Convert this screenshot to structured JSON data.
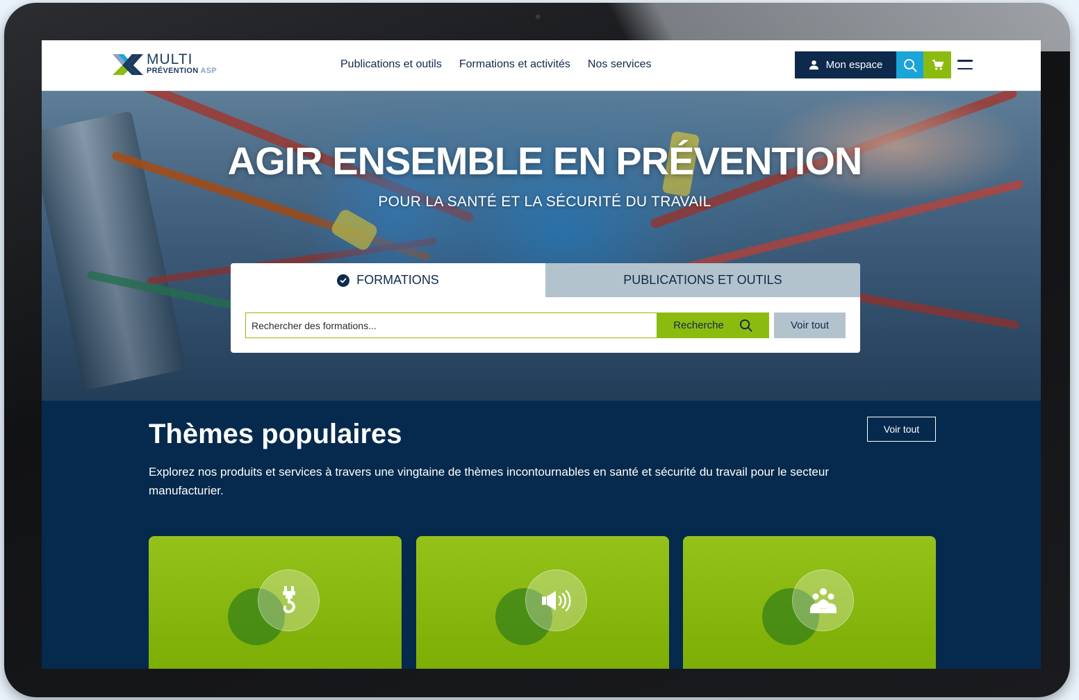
{
  "logo": {
    "line1": "MULTI",
    "line2": "PRÉVENTION",
    "line2_suffix": "ASP"
  },
  "nav": {
    "items": [
      {
        "label": "Publications et outils"
      },
      {
        "label": "Formations et activités"
      },
      {
        "label": "Nos services"
      }
    ]
  },
  "header_actions": {
    "account_label": "Mon espace",
    "account_icon": "user-icon",
    "search_icon": "search-icon",
    "cart_icon": "cart-icon",
    "menu_icon": "hamburger-menu-icon"
  },
  "hero": {
    "title": "AGIR ENSEMBLE EN PRÉVENTION",
    "subtitle": "POUR LA SANTÉ ET LA SÉCURITÉ DU TRAVAIL"
  },
  "search": {
    "tabs": [
      {
        "label": "FORMATIONS",
        "selected": true
      },
      {
        "label": "PUBLICATIONS ET OUTILS",
        "selected": false
      }
    ],
    "placeholder": "Rechercher des formations...",
    "value": "",
    "search_button": "Recherche",
    "view_all_button": "Voir tout"
  },
  "themes": {
    "title": "Thèmes populaires",
    "description": "Explorez nos produits et services à travers une vingtaine de thèmes incontournables en santé et sécurité du travail pour le secteur manufacturier.",
    "view_all_button": "Voir tout",
    "cards": [
      {
        "icon": "crane-hook-icon"
      },
      {
        "icon": "noise-speaker-icon"
      },
      {
        "icon": "people-group-icon"
      }
    ]
  },
  "colors": {
    "navy": "#0d2a4d",
    "themes_bg": "#052a4d",
    "green": "#8cbb10",
    "cyan": "#1aa4d8",
    "tab_inactive": "#b3c3cd"
  }
}
